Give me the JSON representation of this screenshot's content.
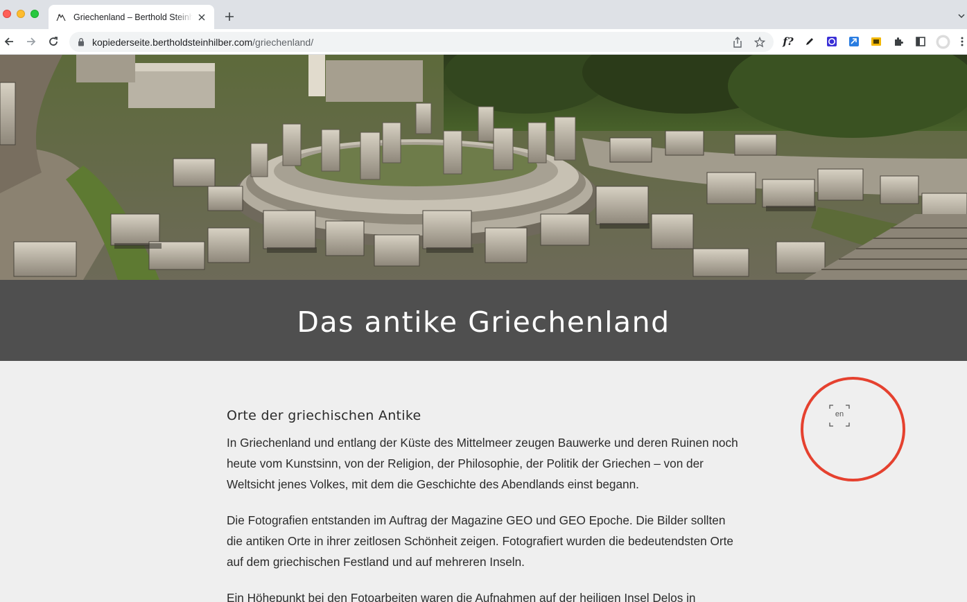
{
  "browser": {
    "tab_title": "Griechenland – Berthold Steinhilber",
    "url_host": "kopiederseite.bertholdsteinhilber.com",
    "url_path": "/griechenland/",
    "extension_fx_label": "f?"
  },
  "page": {
    "title": "Das antike Griechenland",
    "section_heading": "Orte der griechischen Antike",
    "paragraphs": [
      "In Griechenland und entlang der Küste des Mittelmeer zeugen Bauwerke und deren Ruinen noch heute vom Kunstsinn, von der Religion, der Philosophie, der Politik der Griechen – von der Weltsicht jenes Volkes, mit dem die Geschichte des Abendlands einst begann.",
      "Die Fotografien entstanden im Auftrag der Magazine GEO und GEO Epoche. Die Bilder soll­ten die antiken Orte in ihrer zeitlosen Schönheit zeigen. Fotografiert wurden die bedeu­tendsten Orte auf dem griechischen Festland und auf mehreren Inseln.",
      "Ein Höhepunkt bei den Fotoarbeiten waren die Aufnahmen auf der heiligen Insel Delos in"
    ],
    "language_switch": "en"
  },
  "colors": {
    "title_band": "#4f4f4f",
    "page_background": "#efefef",
    "highlight_ring": "#e5412f"
  }
}
